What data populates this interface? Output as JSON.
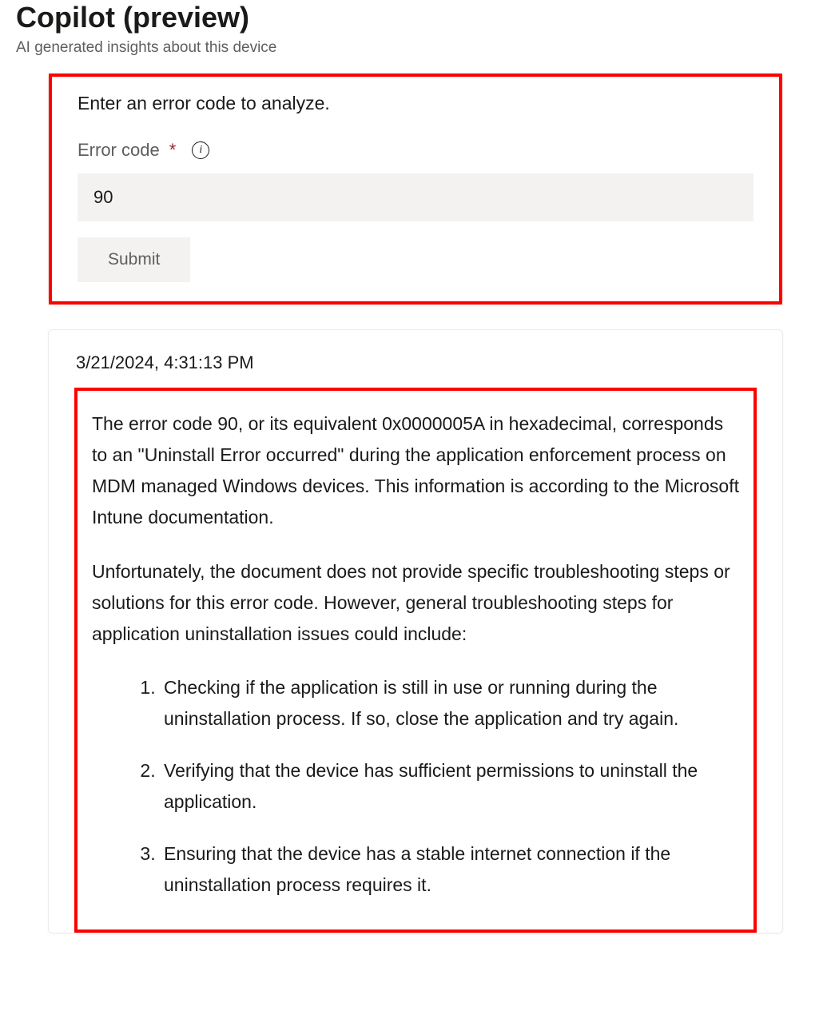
{
  "header": {
    "title": "Copilot (preview)",
    "subtitle": "AI generated insights about this device"
  },
  "inputCard": {
    "prompt": "Enter an error code to analyze.",
    "fieldLabel": "Error code",
    "requiredMark": "*",
    "infoGlyph": "i",
    "inputValue": "90",
    "submitLabel": "Submit"
  },
  "responseCard": {
    "timestamp": "3/21/2024, 4:31:13 PM",
    "paragraph1": "The error code 90, or its equivalent 0x0000005A in hexadecimal, corresponds to an \"Uninstall Error occurred\" during the application enforcement process on MDM managed Windows devices. This information is according to the Microsoft Intune documentation.",
    "paragraph2": "Unfortunately, the document does not provide specific troubleshooting steps or solutions for this error code. However, general troubleshooting steps for application uninstallation issues could include:",
    "steps": [
      "Checking if the application is still in use or running during the uninstallation process. If so, close the application and try again.",
      "Verifying that the device has sufficient permissions to uninstall the application.",
      "Ensuring that the device has a stable internet connection if the uninstallation process requires it."
    ]
  }
}
